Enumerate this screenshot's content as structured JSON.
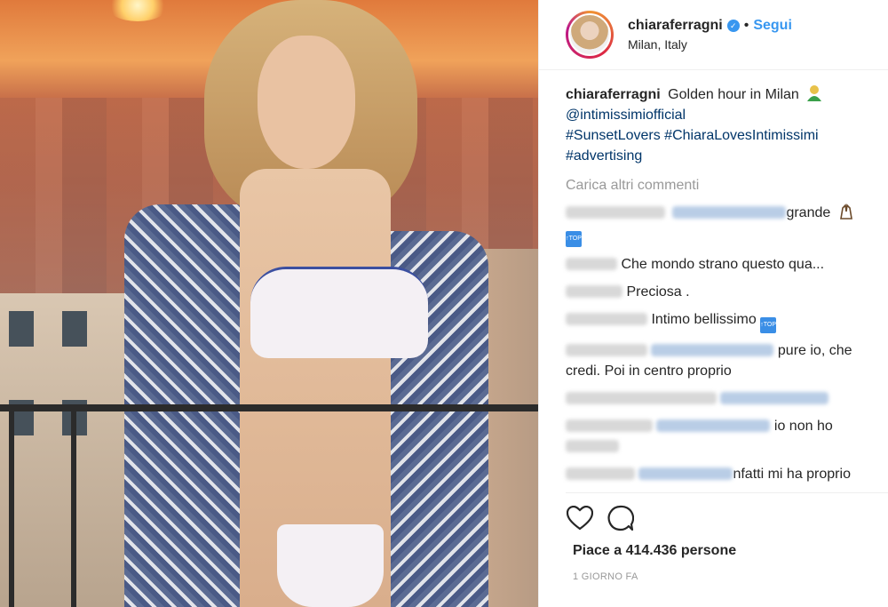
{
  "post": {
    "username": "chiaraferragni",
    "verified_icon": "verified-badge-icon",
    "dot": "•",
    "follow_label": "Segui",
    "location": "Milan, Italy",
    "caption": {
      "username": "chiaraferragni",
      "text": "Golden hour in Milan",
      "mention": "@intimissimiofficial",
      "hashtags": "#SunsetLovers #ChiaraLovesIntimissimi #advertising"
    },
    "load_more": "Carica altri commenti",
    "comments": [
      {
        "text": "grande"
      },
      {
        "text": "Che mondo strano questo qua..."
      },
      {
        "text": "Preciosa ."
      },
      {
        "text": "Intimo bellissimo"
      },
      {
        "text": "pure io, che credi. Poi in centro proprio"
      },
      {
        "text": ""
      },
      {
        "text": "io non ho"
      },
      {
        "text": "nfatti mi ha proprio"
      }
    ],
    "likes_label": "Piace a 414.436 persone",
    "time": "1 GIORNO FA"
  },
  "icons": [
    "heart-icon",
    "comment-icon",
    "top-badge-icon",
    "hands-emoji-icon",
    "person-emoji-icon"
  ],
  "colors": {
    "link": "#003569",
    "follow": "#3897f0",
    "muted": "#999999"
  }
}
